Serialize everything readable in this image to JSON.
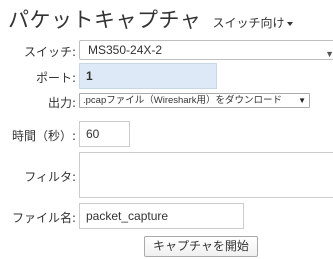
{
  "header": {
    "title": "パケットキャプチャ",
    "switch_menu_label": "スイッチ向け"
  },
  "form": {
    "switch": {
      "label": "スイッチ:",
      "value": "MS350-24X-2"
    },
    "port": {
      "label": "ポート:",
      "value": "1"
    },
    "output": {
      "label": "出力:",
      "value": ".pcapファイル（Wireshark用）をダウンロード"
    },
    "time": {
      "label": "時間（秒）:",
      "value": "60"
    },
    "filter": {
      "label": "フィルタ:",
      "value": ""
    },
    "filename": {
      "label": "ファイル名:",
      "value": "packet_capture"
    },
    "start_button": "キャプチャを開始"
  }
}
